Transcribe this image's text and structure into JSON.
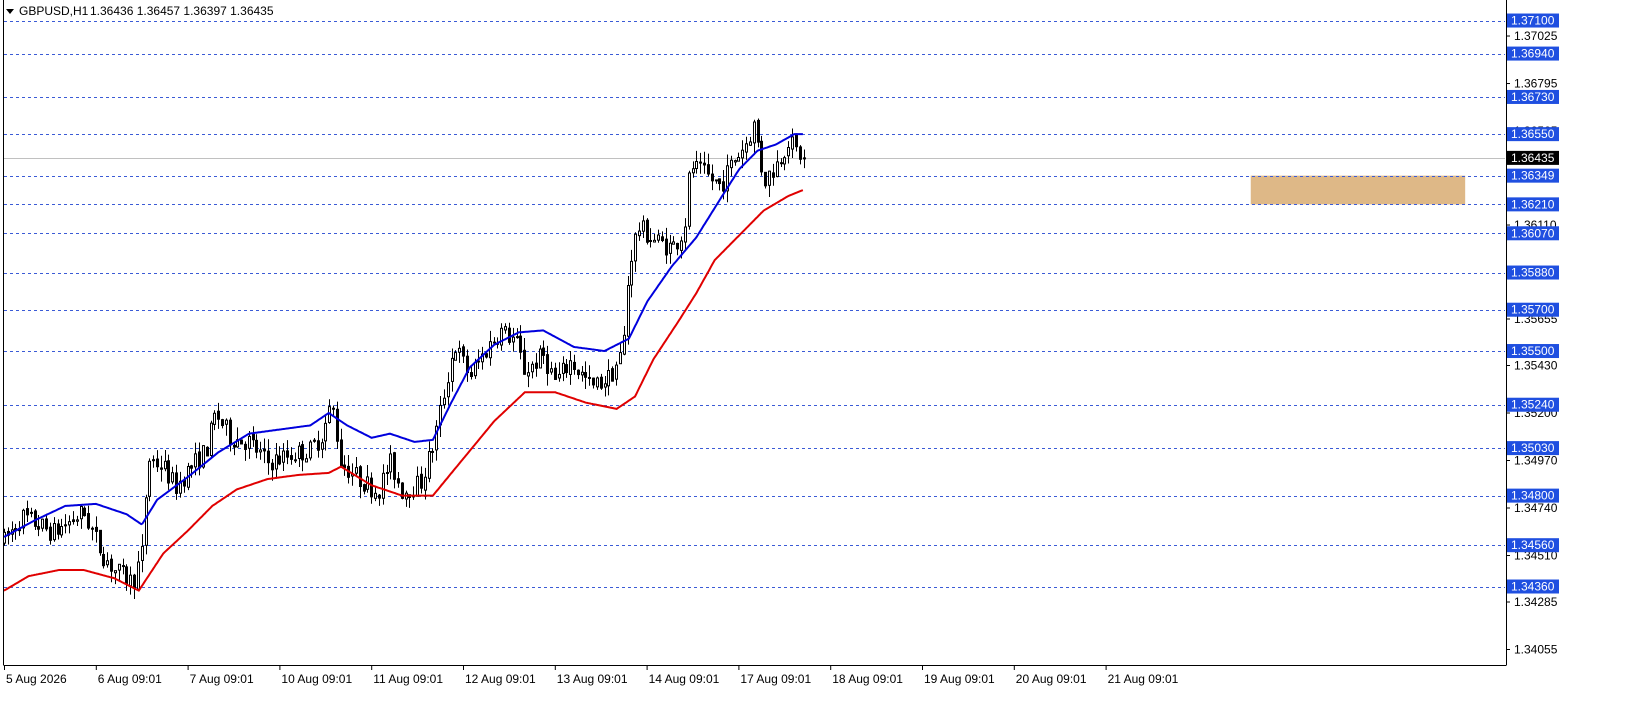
{
  "header": {
    "symbol_label": "GBPUSD,H1",
    "ohlc_label": "1.36436 1.36457 1.36397 1.36435",
    "dropdown_icon": "triangle-down-icon"
  },
  "colors": {
    "background": "#ffffff",
    "candle": "#000000",
    "fast_ma": "#0000dd",
    "slow_ma": "#e00000",
    "level_line": "#3b5bd6",
    "level_label_bg": "#1f4fe0",
    "zone_fill": "#deb887",
    "current_price_line": "#c0c0c0",
    "current_price_bg": "#000000"
  },
  "chart_data": {
    "type": "candlestick",
    "symbol": "GBPUSD",
    "timeframe": "H1",
    "ylim": [
      1.3398,
      1.3718
    ],
    "y_ticks": [
      "1.37100",
      "1.37025",
      "1.36940",
      "1.36795",
      "1.36730",
      "1.36565",
      "1.36550",
      "1.36435",
      "1.36349",
      "1.36210",
      "1.36110",
      "1.36070",
      "1.35880",
      "1.35700",
      "1.35655",
      "1.35500",
      "1.35430",
      "1.35240",
      "1.35200",
      "1.35030",
      "1.34970",
      "1.34800",
      "1.34740",
      "1.34560",
      "1.34510",
      "1.34360",
      "1.34285",
      "1.34055"
    ],
    "x_ticks": [
      "5 Aug 2026",
      "6 Aug 09:01",
      "7 Aug 09:01",
      "10 Aug 09:01",
      "11 Aug 09:01",
      "12 Aug 09:01",
      "13 Aug 09:01",
      "14 Aug 09:01",
      "17 Aug 09:01",
      "18 Aug 09:01",
      "19 Aug 09:01",
      "20 Aug 09:01",
      "21 Aug 09:01"
    ],
    "levels": [
      {
        "value": 1.371,
        "label": "1.37100"
      },
      {
        "value": 1.3694,
        "label": "1.36940"
      },
      {
        "value": 1.3673,
        "label": "1.36730"
      },
      {
        "value": 1.3655,
        "label": "1.36550"
      },
      {
        "value": 1.36349,
        "label": "1.36349"
      },
      {
        "value": 1.3621,
        "label": "1.36210"
      },
      {
        "value": 1.3607,
        "label": "1.36070"
      },
      {
        "value": 1.3588,
        "label": "1.35880"
      },
      {
        "value": 1.357,
        "label": "1.35700"
      },
      {
        "value": 1.355,
        "label": "1.35500"
      },
      {
        "value": 1.3524,
        "label": "1.35240"
      },
      {
        "value": 1.3503,
        "label": "1.35030"
      },
      {
        "value": 1.348,
        "label": "1.34800"
      },
      {
        "value": 1.3456,
        "label": "1.34560"
      },
      {
        "value": 1.3436,
        "label": "1.34360"
      }
    ],
    "current_price": {
      "value": 1.36435,
      "label": "1.36435"
    },
    "zone": {
      "top": 1.36349,
      "bottom": 1.3621,
      "start_time": 20.35,
      "end_time": 23.85
    },
    "time_range": [
      0,
      24.5
    ],
    "anchors": [
      [
        0.0,
        1.3458
      ],
      [
        0.3,
        1.347
      ],
      [
        0.8,
        1.3462
      ],
      [
        1.3,
        1.3472
      ],
      [
        1.6,
        1.3452
      ],
      [
        1.8,
        1.3444
      ],
      [
        2.1,
        1.3438
      ],
      [
        2.25,
        1.3452
      ],
      [
        2.35,
        1.3498
      ],
      [
        2.6,
        1.3494
      ],
      [
        2.8,
        1.3484
      ],
      [
        3.0,
        1.3492
      ],
      [
        3.3,
        1.3502
      ],
      [
        3.45,
        1.352
      ],
      [
        3.7,
        1.3508
      ],
      [
        4.0,
        1.3506
      ],
      [
        4.3,
        1.3496
      ],
      [
        4.7,
        1.35
      ],
      [
        5.0,
        1.3502
      ],
      [
        5.2,
        1.351
      ],
      [
        5.35,
        1.3525
      ],
      [
        5.5,
        1.3496
      ],
      [
        5.8,
        1.3488
      ],
      [
        6.1,
        1.3482
      ],
      [
        6.3,
        1.3496
      ],
      [
        6.5,
        1.3482
      ],
      [
        6.8,
        1.3486
      ],
      [
        7.0,
        1.3504
      ],
      [
        7.2,
        1.3532
      ],
      [
        7.35,
        1.3553
      ],
      [
        7.6,
        1.3538
      ],
      [
        7.9,
        1.3552
      ],
      [
        8.1,
        1.356
      ],
      [
        8.35,
        1.3555
      ],
      [
        8.5,
        1.354
      ],
      [
        8.8,
        1.3548
      ],
      [
        9.0,
        1.3535
      ],
      [
        9.25,
        1.3545
      ],
      [
        9.6,
        1.3532
      ],
      [
        9.9,
        1.3538
      ],
      [
        10.1,
        1.355
      ],
      [
        10.2,
        1.3592
      ],
      [
        10.35,
        1.361
      ],
      [
        10.6,
        1.3604
      ],
      [
        10.9,
        1.36
      ],
      [
        11.1,
        1.3608
      ],
      [
        11.2,
        1.364
      ],
      [
        11.4,
        1.3636
      ],
      [
        11.7,
        1.363
      ],
      [
        11.9,
        1.3642
      ],
      [
        12.1,
        1.365
      ],
      [
        12.25,
        1.366
      ],
      [
        12.4,
        1.3632
      ],
      [
        12.6,
        1.364
      ],
      [
        12.8,
        1.3652
      ],
      [
        12.95,
        1.3646
      ],
      [
        13.05,
        1.36435
      ]
    ],
    "fast_ma_anchors": [
      [
        0.0,
        1.346
      ],
      [
        0.5,
        1.3468
      ],
      [
        1.0,
        1.3475
      ],
      [
        1.5,
        1.3476
      ],
      [
        2.0,
        1.3471
      ],
      [
        2.25,
        1.3466
      ],
      [
        2.5,
        1.3478
      ],
      [
        3.0,
        1.3489
      ],
      [
        3.5,
        1.3501
      ],
      [
        4.0,
        1.351
      ],
      [
        4.5,
        1.3512
      ],
      [
        5.0,
        1.3514
      ],
      [
        5.3,
        1.352
      ],
      [
        5.6,
        1.3514
      ],
      [
        6.0,
        1.3508
      ],
      [
        6.3,
        1.351
      ],
      [
        6.7,
        1.3506
      ],
      [
        7.0,
        1.3507
      ],
      [
        7.3,
        1.3525
      ],
      [
        7.6,
        1.3542
      ],
      [
        8.0,
        1.3553
      ],
      [
        8.4,
        1.3559
      ],
      [
        8.8,
        1.356
      ],
      [
        9.3,
        1.3552
      ],
      [
        9.8,
        1.355
      ],
      [
        10.2,
        1.3556
      ],
      [
        10.5,
        1.3574
      ],
      [
        10.9,
        1.3591
      ],
      [
        11.3,
        1.3605
      ],
      [
        11.7,
        1.3624
      ],
      [
        12.0,
        1.3638
      ],
      [
        12.3,
        1.3647
      ],
      [
        12.6,
        1.365
      ],
      [
        12.9,
        1.3655
      ],
      [
        13.05,
        1.3655
      ]
    ],
    "slow_ma_anchors": [
      [
        0.0,
        1.3434
      ],
      [
        0.4,
        1.3441
      ],
      [
        0.9,
        1.3444
      ],
      [
        1.3,
        1.3444
      ],
      [
        1.8,
        1.344
      ],
      [
        2.2,
        1.3434
      ],
      [
        2.6,
        1.3452
      ],
      [
        3.0,
        1.3463
      ],
      [
        3.4,
        1.3475
      ],
      [
        3.8,
        1.3483
      ],
      [
        4.3,
        1.3488
      ],
      [
        4.8,
        1.349
      ],
      [
        5.3,
        1.3491
      ],
      [
        5.5,
        1.3494
      ],
      [
        6.0,
        1.3485
      ],
      [
        6.5,
        1.348
      ],
      [
        7.0,
        1.348
      ],
      [
        7.5,
        1.3498
      ],
      [
        8.0,
        1.3516
      ],
      [
        8.5,
        1.353
      ],
      [
        9.0,
        1.353
      ],
      [
        9.5,
        1.3525
      ],
      [
        10.0,
        1.3522
      ],
      [
        10.3,
        1.3528
      ],
      [
        10.6,
        1.3546
      ],
      [
        11.0,
        1.3564
      ],
      [
        11.3,
        1.3578
      ],
      [
        11.6,
        1.3594
      ],
      [
        12.0,
        1.3606
      ],
      [
        12.4,
        1.3618
      ],
      [
        12.8,
        1.3625
      ],
      [
        13.05,
        1.3628
      ]
    ],
    "candle_count": 210,
    "grid": false,
    "legend": "none"
  }
}
